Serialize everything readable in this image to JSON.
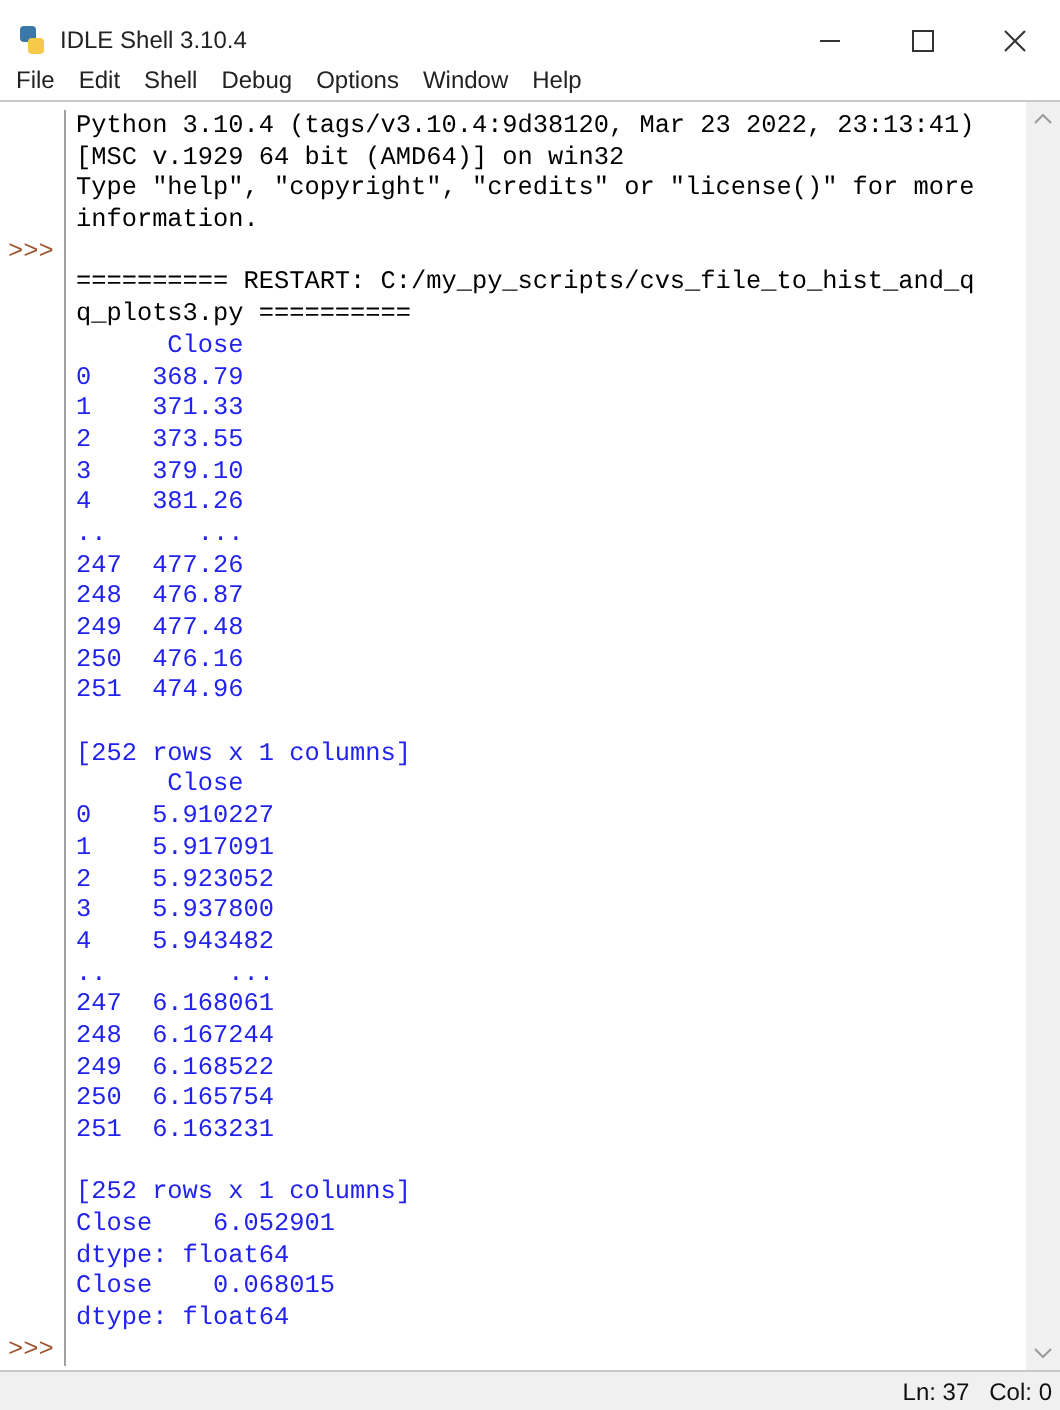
{
  "window": {
    "title": "IDLE Shell 3.10.4"
  },
  "menu": [
    "File",
    "Edit",
    "Shell",
    "Debug",
    "Options",
    "Window",
    "Help"
  ],
  "lines": [
    {
      "kind": "output",
      "text": "Python 3.10.4 (tags/v3.10.4:9d38120, Mar 23 2022, 23:13:41)"
    },
    {
      "kind": "output",
      "text": "[MSC v.1929 64 bit (AMD64)] on win32"
    },
    {
      "kind": "output",
      "text": "Type \"help\", \"copyright\", \"credits\" or \"license()\" for more"
    },
    {
      "kind": "output",
      "text": "information."
    },
    {
      "kind": "blank",
      "prompt": ">>>"
    },
    {
      "kind": "output",
      "text": "========== RESTART: C:/my_py_scripts/cvs_file_to_hist_and_q"
    },
    {
      "kind": "output",
      "text": "q_plots3.py =========="
    },
    {
      "kind": "stdout",
      "text": "      Close"
    },
    {
      "kind": "stdout",
      "text": "0    368.79"
    },
    {
      "kind": "stdout",
      "text": "1    371.33"
    },
    {
      "kind": "stdout",
      "text": "2    373.55"
    },
    {
      "kind": "stdout",
      "text": "3    379.10"
    },
    {
      "kind": "stdout",
      "text": "4    381.26"
    },
    {
      "kind": "stdout",
      "text": "..      ..."
    },
    {
      "kind": "stdout",
      "text": "247  477.26"
    },
    {
      "kind": "stdout",
      "text": "248  476.87"
    },
    {
      "kind": "stdout",
      "text": "249  477.48"
    },
    {
      "kind": "stdout",
      "text": "250  476.16"
    },
    {
      "kind": "stdout",
      "text": "251  474.96"
    },
    {
      "kind": "blank"
    },
    {
      "kind": "stdout",
      "text": "[252 rows x 1 columns]"
    },
    {
      "kind": "stdout",
      "text": "      Close"
    },
    {
      "kind": "stdout",
      "text": "0    5.910227"
    },
    {
      "kind": "stdout",
      "text": "1    5.917091"
    },
    {
      "kind": "stdout",
      "text": "2    5.923052"
    },
    {
      "kind": "stdout",
      "text": "3    5.937800"
    },
    {
      "kind": "stdout",
      "text": "4    5.943482"
    },
    {
      "kind": "stdout",
      "text": "..        ..."
    },
    {
      "kind": "stdout",
      "text": "247  6.168061"
    },
    {
      "kind": "stdout",
      "text": "248  6.167244"
    },
    {
      "kind": "stdout",
      "text": "249  6.168522"
    },
    {
      "kind": "stdout",
      "text": "250  6.165754"
    },
    {
      "kind": "stdout",
      "text": "251  6.163231"
    },
    {
      "kind": "blank"
    },
    {
      "kind": "stdout",
      "text": "[252 rows x 1 columns]"
    },
    {
      "kind": "stdout",
      "text": "Close    6.052901"
    },
    {
      "kind": "stdout",
      "text": "dtype: float64"
    },
    {
      "kind": "stdout",
      "text": "Close    0.068015"
    },
    {
      "kind": "stdout",
      "text": "dtype: float64"
    },
    {
      "kind": "blank",
      "prompt": ">>>"
    }
  ],
  "status_bar": {
    "line": "Ln: 37",
    "column": "Col: 0"
  }
}
